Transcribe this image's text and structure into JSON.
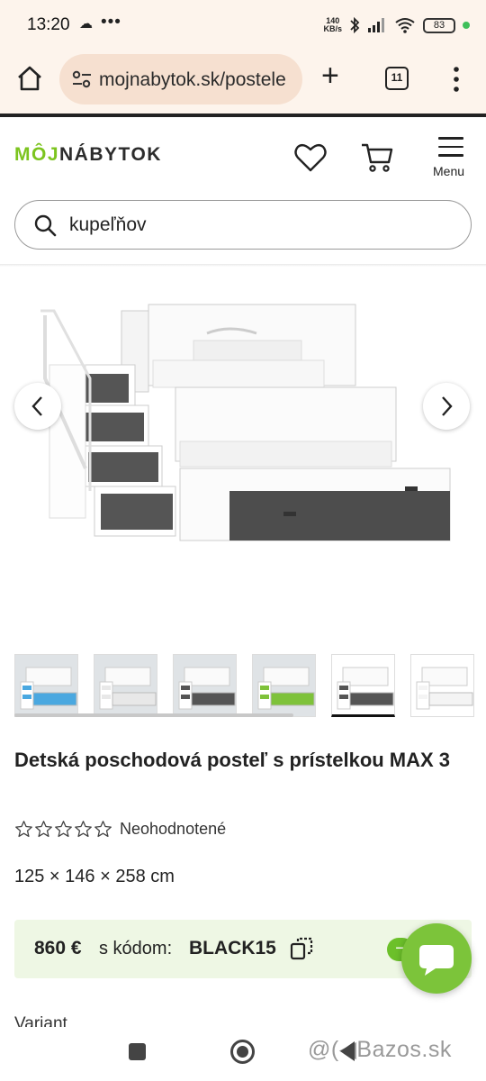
{
  "status_bar": {
    "time": "13:20",
    "net_speed_value": "140",
    "net_speed_unit": "KB/s",
    "battery": "83"
  },
  "browser": {
    "url": "mojnabytok.sk/postele",
    "tab_count": "11"
  },
  "site": {
    "logo_part1": "MÔJ",
    "logo_part2": "NÁBYTOK",
    "menu_label": "Menu",
    "search_value": "kupeľňov",
    "brand_green": "#7cc41f"
  },
  "product": {
    "title": "Detská poschodová posteľ s prístelkou MAX 3",
    "rating_text": "Neohodnotené",
    "stars_filled": 0,
    "stars_total": 5,
    "dimensions": "125 × 146 × 258 cm",
    "promo_price": "860 €",
    "promo_code_label": "s kódom:",
    "promo_code": "BLACK15",
    "variant_label": "Variant",
    "thumbnails": [
      {
        "accent": "#4aa8e0",
        "active": false
      },
      {
        "accent": "#e8e8e8",
        "active": false
      },
      {
        "accent": "#555555",
        "active": false
      },
      {
        "accent": "#7ec23a",
        "active": false
      },
      {
        "accent": "#555555",
        "active": true
      },
      {
        "accent": "#f4f4f4",
        "active": false
      }
    ]
  },
  "watermark": "@(◀Bazos.sk"
}
